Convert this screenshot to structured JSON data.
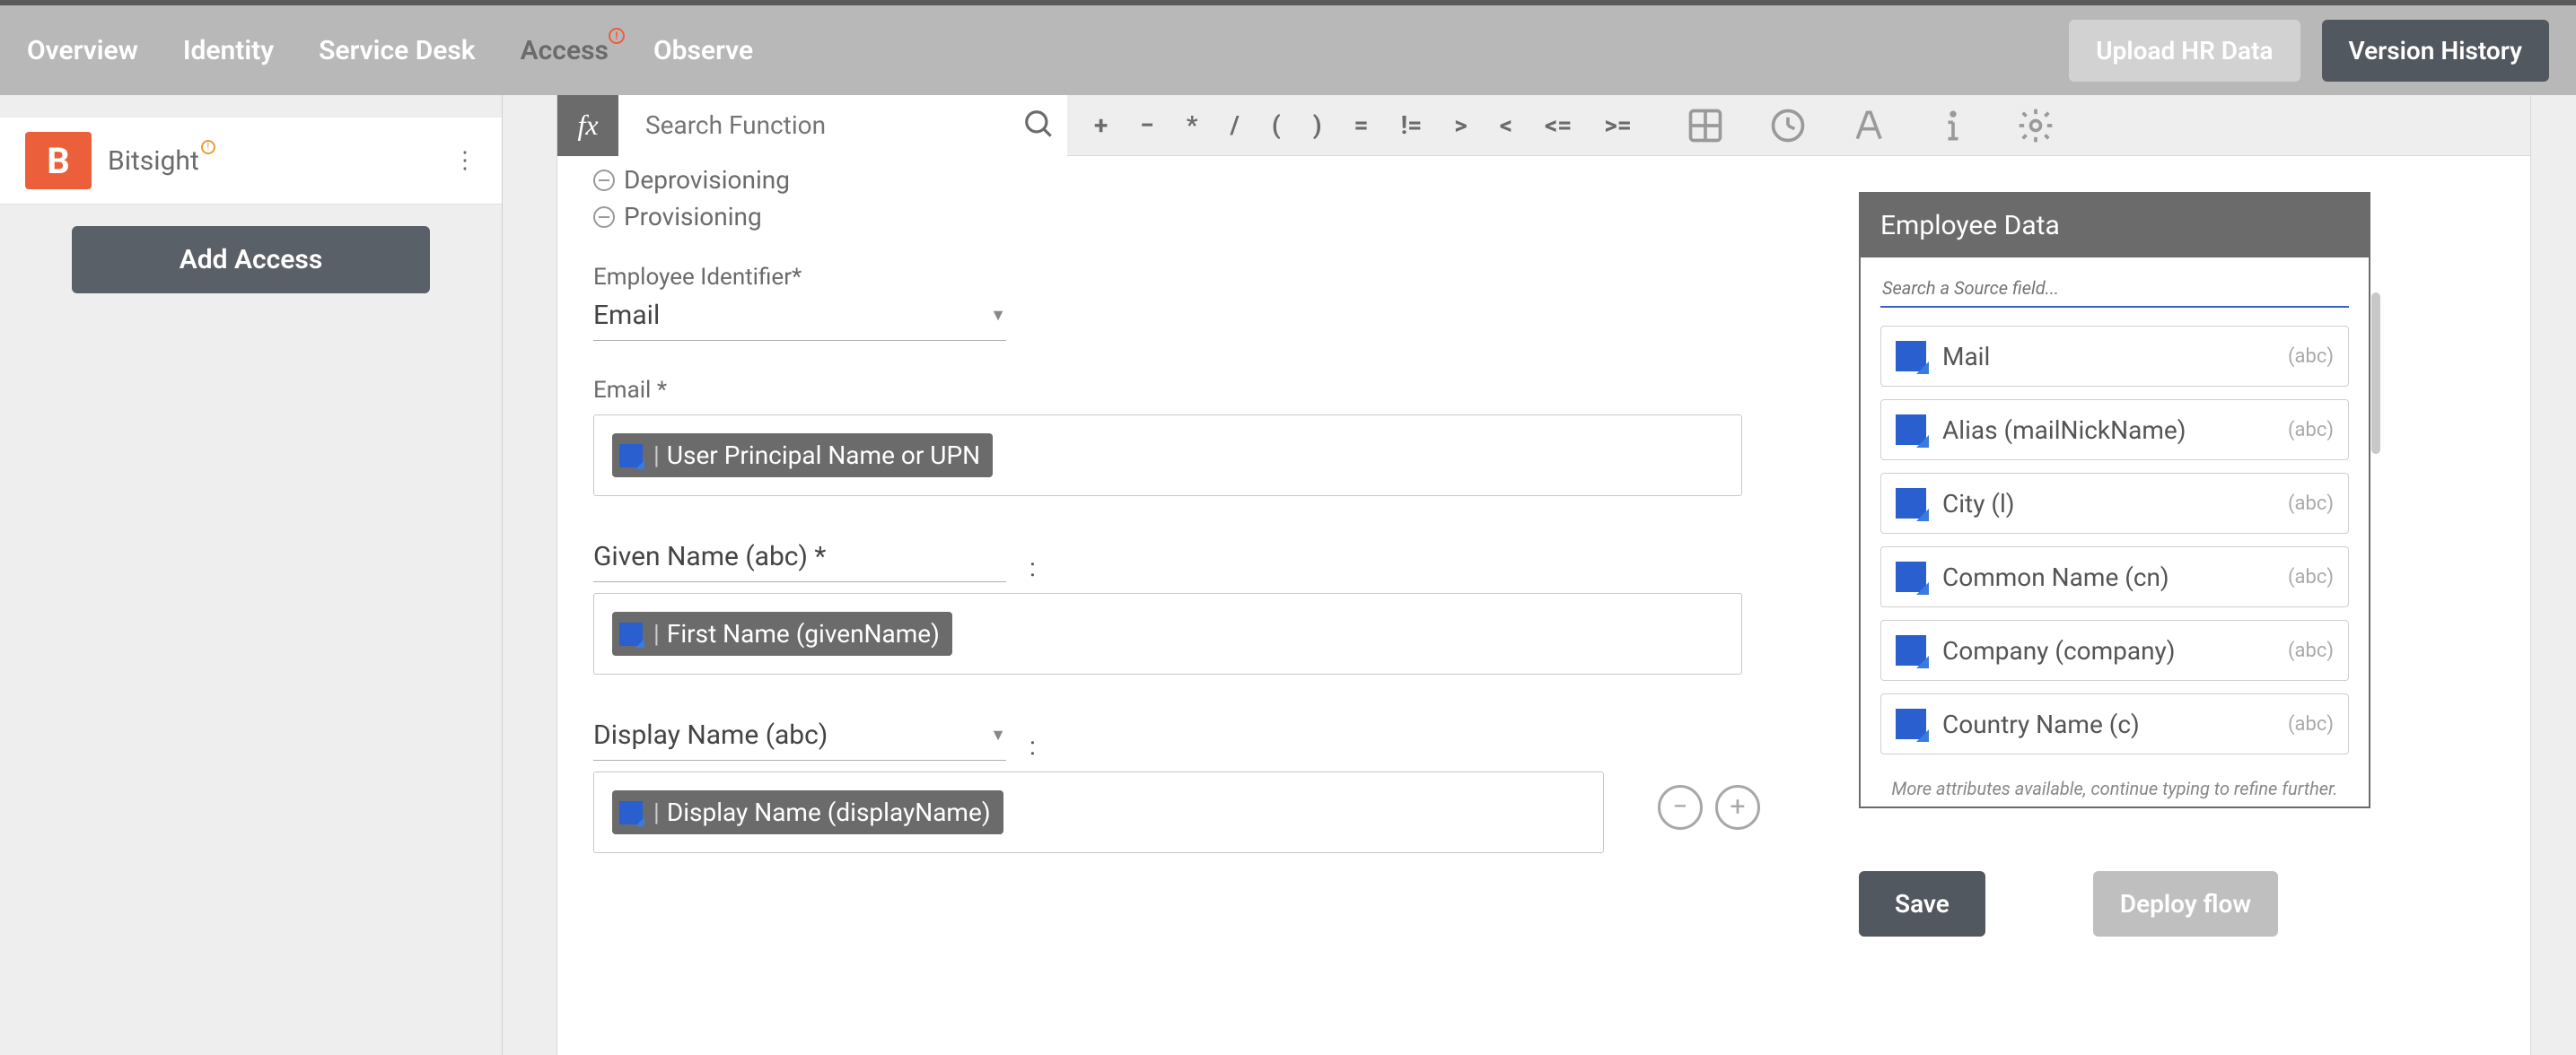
{
  "nav": {
    "items": [
      "Overview",
      "Identity",
      "Service Desk",
      "Access",
      "Observe"
    ],
    "activeIndex": 3,
    "upload": "Upload HR Data",
    "version": "Version History"
  },
  "sidebar": {
    "app_name": "Bitsight",
    "add_access": "Add Access"
  },
  "fx": {
    "placeholder": "Search Function",
    "ops": [
      "+",
      "−",
      "*",
      "/",
      "(",
      ")",
      "=",
      "!=",
      ">",
      "<",
      "<=",
      ">="
    ]
  },
  "tree": {
    "deprovisioning": "Deprovisioning",
    "provisioning": "Provisioning"
  },
  "form": {
    "emp_id_label": "Employee Identifier*",
    "emp_id_value": "Email",
    "email_label": "Email *",
    "email_chip": "User Principal Name or UPN",
    "given_label": "Given Name (abc) *",
    "given_chip": "First Name (givenName)",
    "display_label": "Display Name (abc)",
    "display_chip": "Display Name (displayName)"
  },
  "emp_panel": {
    "title": "Employee Data",
    "search_placeholder": "Search a Source field...",
    "items": [
      {
        "name": "Mail",
        "type": "(abc)"
      },
      {
        "name": "Alias (mailNickName)",
        "type": "(abc)"
      },
      {
        "name": "City (l)",
        "type": "(abc)"
      },
      {
        "name": "Common Name (cn)",
        "type": "(abc)"
      },
      {
        "name": "Company (company)",
        "type": "(abc)"
      },
      {
        "name": "Country Name (c)",
        "type": "(abc)"
      }
    ],
    "more": "More attributes available, continue typing to refine further."
  },
  "buttons": {
    "save": "Save",
    "deploy": "Deploy flow"
  }
}
